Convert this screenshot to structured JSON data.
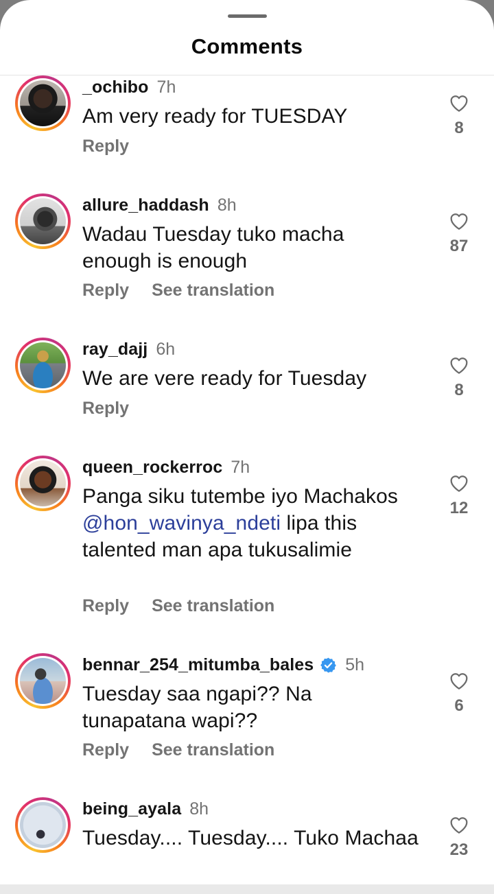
{
  "sheet": {
    "title": "Comments"
  },
  "comments": [
    {
      "username": "_ochibo",
      "time": "7h",
      "text": "Am very ready for TUESDAY",
      "mention": "",
      "text_after": "",
      "actions": [
        "Reply"
      ],
      "likes": "8",
      "verified": false
    },
    {
      "username": "allure_haddash",
      "time": "8h",
      "text": "Wadau Tuesday tuko macha enough is enough",
      "mention": "",
      "text_after": "",
      "actions": [
        "Reply",
        "See translation"
      ],
      "likes": "87",
      "verified": false
    },
    {
      "username": "ray_dajj",
      "time": "6h",
      "text": "We are vere ready for Tuesday",
      "mention": "",
      "text_after": "",
      "actions": [
        "Reply"
      ],
      "likes": "8",
      "verified": false
    },
    {
      "username": "queen_rockerroc",
      "time": "7h",
      "text": "Panga siku tutembe iyo Machakos ",
      "mention": "@hon_wavinya_ndeti",
      "text_after": " lipa this talented man apa tukusalimie",
      "actions": [
        "Reply",
        "See translation"
      ],
      "likes": "12",
      "verified": false
    },
    {
      "username": "bennar_254_mitumba_bales",
      "time": "5h",
      "text": "Tuesday saa ngapi?? Na tunapatana wapi??",
      "mention": "",
      "text_after": "",
      "actions": [
        "Reply",
        "See translation"
      ],
      "likes": "6",
      "verified": true
    },
    {
      "username": "being_ayala",
      "time": "8h",
      "text": "Tuesday.... Tuesday.... Tuko Machaa",
      "mention": "",
      "text_after": "",
      "actions": [],
      "likes": "23",
      "verified": false
    }
  ],
  "icons": {
    "like": "heart-outline-icon",
    "verified": "verified-badge-icon"
  },
  "colors": {
    "ring_start": "#f9c22e",
    "ring_end": "#c13584",
    "mention": "#2c3f9a",
    "verified": "#3797f0",
    "muted": "#737373"
  }
}
